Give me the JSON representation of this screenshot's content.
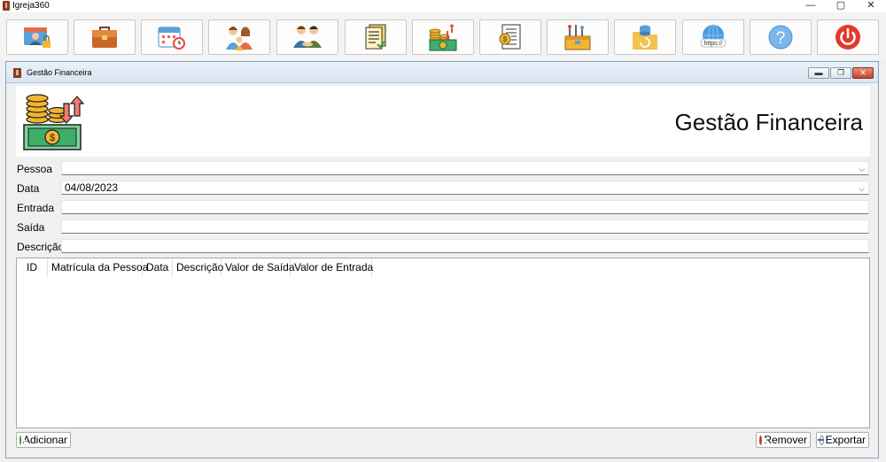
{
  "app": {
    "title": "Igreja360",
    "controls": {
      "minimize": "—",
      "maximize": "▢",
      "close": "✕"
    }
  },
  "toolbar": {
    "buttons": [
      {
        "name": "members-badge",
        "icon": "id-badge-lock-icon"
      },
      {
        "name": "briefcase",
        "icon": "briefcase-icon"
      },
      {
        "name": "calendar",
        "icon": "calendar-clock-icon"
      },
      {
        "name": "family",
        "icon": "family-icon"
      },
      {
        "name": "handshake",
        "icon": "handshake-icon"
      },
      {
        "name": "documents",
        "icon": "documents-icon"
      },
      {
        "name": "finance",
        "icon": "money-coins-icon"
      },
      {
        "name": "receipt",
        "icon": "receipt-scroll-icon"
      },
      {
        "name": "tools",
        "icon": "toolbox-icon"
      },
      {
        "name": "backup",
        "icon": "database-folder-icon"
      },
      {
        "name": "website",
        "icon": "globe-https-icon"
      },
      {
        "name": "help",
        "icon": "question-icon"
      },
      {
        "name": "power",
        "icon": "power-icon"
      }
    ]
  },
  "window": {
    "title": "Gestão Financeira",
    "controls": {
      "minimize": "▬",
      "restore": "❐",
      "close": "✕"
    }
  },
  "header": {
    "title": "Gestão Financeira",
    "logo_icon": "money-coins-icon"
  },
  "form": {
    "pessoa_label": "Pessoa",
    "pessoa_value": "",
    "data_label": "Data",
    "data_value": "04/08/2023",
    "entrada_label": "Entrada",
    "entrada_value": "",
    "saida_label": "Saída",
    "saida_value": "",
    "descricao_label": "Descrição",
    "descricao_value": "",
    "dropdown_glyph": "⌵"
  },
  "grid": {
    "columns": [
      "ID",
      "Matrícula da Pessoa",
      "Data",
      "Descrição",
      "Valor de Saída",
      "Valor de Entrada"
    ],
    "rows": []
  },
  "actions": {
    "add_label": "Adicionar",
    "remove_label": "Remover",
    "export_label": "Exportar"
  },
  "colors": {
    "accent_red": "#d23b2e",
    "accent_green": "#3a9a2e",
    "money_green": "#3fae6a",
    "coin_gold": "#f2b531"
  }
}
